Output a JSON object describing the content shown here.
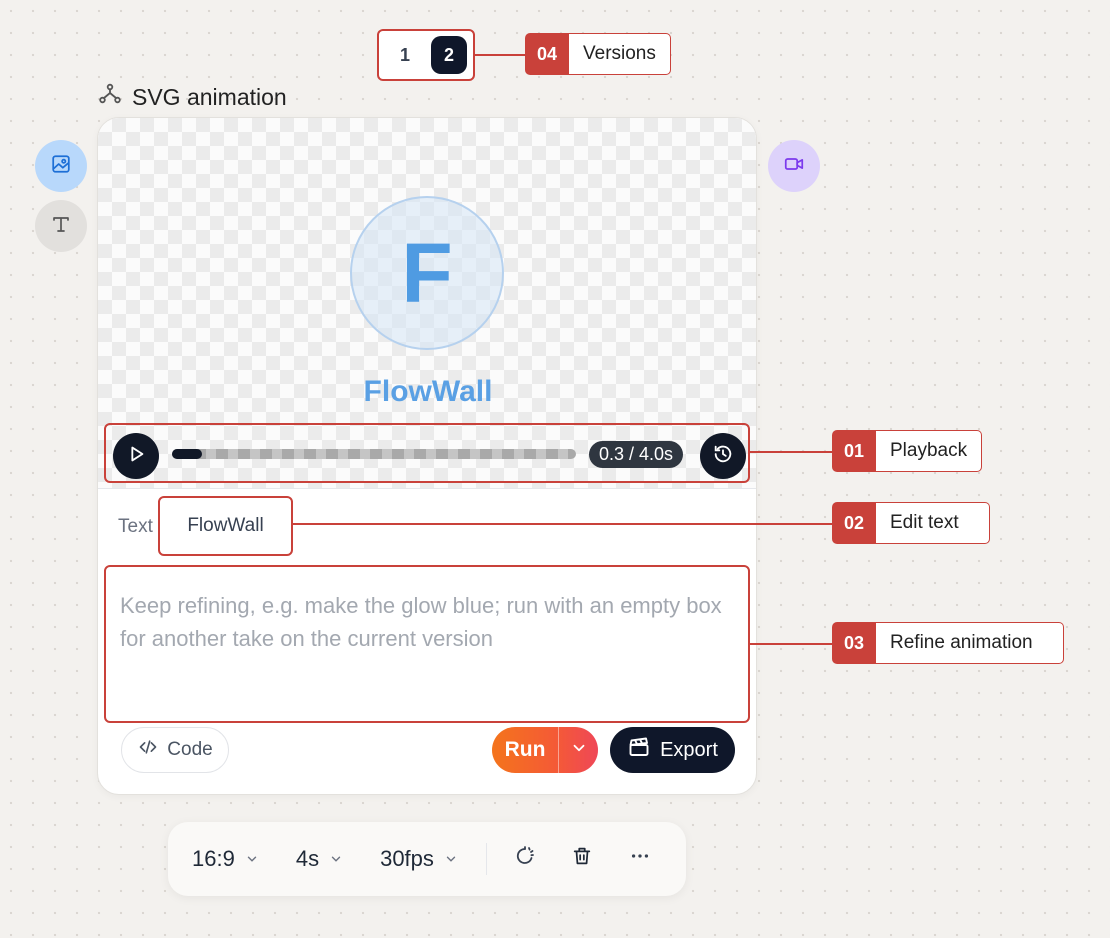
{
  "versions": {
    "items": [
      "1",
      "2"
    ],
    "active": "2"
  },
  "title": "SVG animation",
  "canvas": {
    "logo_letter": "F",
    "brand_text": "FlowWall"
  },
  "playback": {
    "time": "0.3 / 4.0s",
    "progress": 0.075
  },
  "text_field": {
    "label": "Text",
    "value": "FlowWall"
  },
  "refine": {
    "placeholder": "Keep refining, e.g. make the glow blue; run with an empty box for another take on the current version"
  },
  "actions": {
    "code_label": "Code",
    "run_label": "Run",
    "export_label": "Export"
  },
  "toolbar": {
    "aspect": "16:9",
    "duration": "4s",
    "fps": "30fps"
  },
  "callouts": [
    {
      "num": "01",
      "label": "Playback"
    },
    {
      "num": "02",
      "label": "Edit text"
    },
    {
      "num": "03",
      "label": "Refine animation"
    },
    {
      "num": "04",
      "label": "Versions"
    }
  ],
  "icons": {
    "title": "node-graph-icon",
    "left_top": "image-icon",
    "left_bottom": "text-type-icon",
    "right": "video-icon",
    "play": "play-icon",
    "reset": "history-icon",
    "code": "code-icon",
    "run_dropdown": "chevron-down-icon",
    "export": "clapperboard-icon",
    "effects": "sparkle-loader-icon",
    "delete": "trash-icon",
    "more": "more-horizontal-icon"
  },
  "colors": {
    "annotation": "#c9413a",
    "brand_blue": "#5aa0e4",
    "dark": "#0f172a",
    "run_orange": "#f4741c",
    "run_red": "#ef4757"
  }
}
